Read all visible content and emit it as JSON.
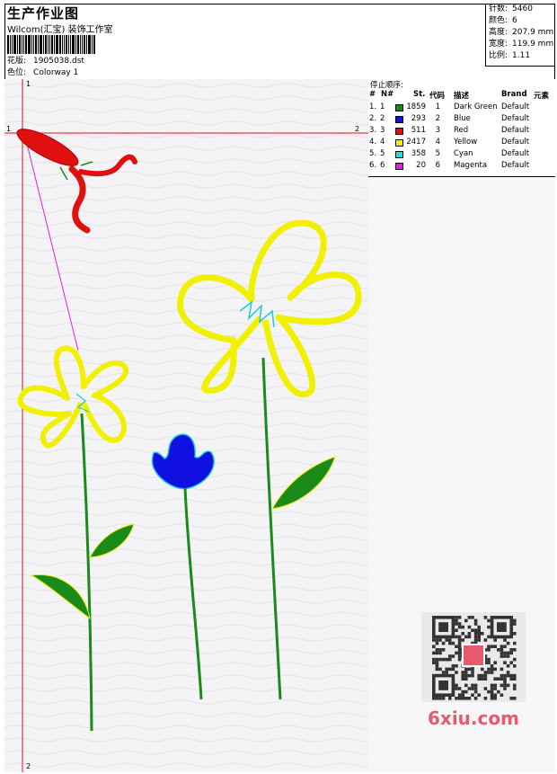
{
  "header": {
    "title": "生产作业图",
    "company": "Wilcom(汇宝) 装饰工作室",
    "design_label": "花版:",
    "design_value": "1905038.dst",
    "colorway_label": "色位:",
    "colorway_value": "Colorway 1"
  },
  "stats": [
    {
      "label": "针数:",
      "value": "5460"
    },
    {
      "label": "颜色:",
      "value": "6"
    },
    {
      "label": "高度:",
      "value": "207.9 mm"
    },
    {
      "label": "宽度:",
      "value": "119.9 mm"
    },
    {
      "label": "比例:",
      "value": "1.11"
    }
  ],
  "stop_sequence": {
    "title": "停止顺序:",
    "columns": [
      "#",
      "N#",
      "St.",
      "代码",
      "描述",
      "Brand",
      "元素"
    ],
    "rows": [
      {
        "num": "1.",
        "n": "1",
        "color": "#1a8a1a",
        "stitches": "1859",
        "code": "1",
        "desc": "Dark Green",
        "brand": "Default"
      },
      {
        "num": "2.",
        "n": "2",
        "color": "#1010e0",
        "stitches": "293",
        "code": "2",
        "desc": "Blue",
        "brand": "Default"
      },
      {
        "num": "3.",
        "n": "3",
        "color": "#e01010",
        "stitches": "511",
        "code": "3",
        "desc": "Red",
        "brand": "Default"
      },
      {
        "num": "4.",
        "n": "4",
        "color": "#f0f000",
        "stitches": "2417",
        "code": "4",
        "desc": "Yellow",
        "brand": "Default"
      },
      {
        "num": "5.",
        "n": "5",
        "color": "#20e0e0",
        "stitches": "358",
        "code": "5",
        "desc": "Cyan",
        "brand": "Default"
      },
      {
        "num": "6.",
        "n": "6",
        "color": "#e020e0",
        "stitches": "20",
        "code": "6",
        "desc": "Magenta",
        "brand": "Default"
      }
    ]
  },
  "canvas_marks": {
    "top": "1",
    "left": "1",
    "right": "2",
    "bottom": "2"
  },
  "watermark": {
    "domain": "6xiu",
    "tld": ".com"
  }
}
